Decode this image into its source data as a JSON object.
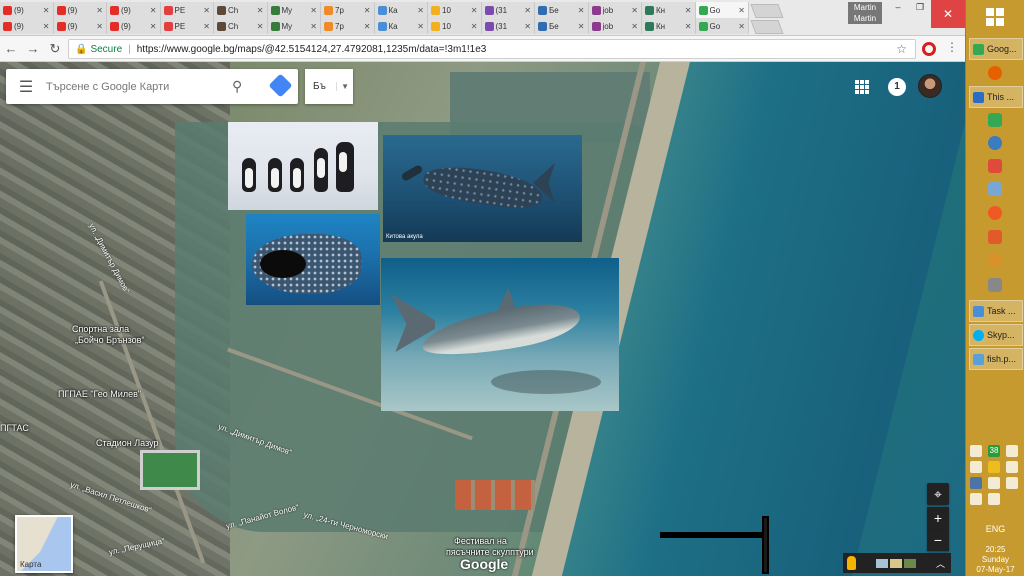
{
  "browser": {
    "tabs_row1": [
      {
        "label": "(9)",
        "color": "#e52d27"
      },
      {
        "label": "(9)",
        "color": "#e52d27"
      },
      {
        "label": "(9)",
        "color": "#e52d27"
      },
      {
        "label": "PE",
        "color": "#e43f3f"
      },
      {
        "label": "Ch",
        "color": "#5b4a3a"
      },
      {
        "label": "My",
        "color": "#3a7a3a"
      },
      {
        "label": "7p",
        "color": "#f08a24"
      },
      {
        "label": "Ка",
        "color": "#4a8fd6"
      },
      {
        "label": "10",
        "color": "#f2b01e"
      },
      {
        "label": "(31",
        "color": "#7d4bb0"
      },
      {
        "label": "Бе",
        "color": "#2f6db0"
      },
      {
        "label": "job",
        "color": "#8e3a8e"
      },
      {
        "label": "Кн",
        "color": "#2c7a5a"
      },
      {
        "label": "Go",
        "color": "#34a853"
      }
    ],
    "tabs_row2": [
      {
        "label": "(9)",
        "color": "#e52d27"
      },
      {
        "label": "(9)",
        "color": "#e52d27"
      },
      {
        "label": "(9)",
        "color": "#e52d27"
      },
      {
        "label": "PE",
        "color": "#e43f3f"
      },
      {
        "label": "Ch",
        "color": "#5b4a3a"
      },
      {
        "label": "My",
        "color": "#3a7a3a"
      },
      {
        "label": "7p",
        "color": "#f08a24"
      },
      {
        "label": "Ка",
        "color": "#4a8fd6"
      },
      {
        "label": "10",
        "color": "#f2b01e"
      },
      {
        "label": "(31",
        "color": "#7d4bb0"
      },
      {
        "label": "Бе",
        "color": "#2f6db0"
      },
      {
        "label": "job",
        "color": "#8e3a8e"
      },
      {
        "label": "Кн",
        "color": "#2c7a5a"
      },
      {
        "label": "Go",
        "color": "#34a853"
      }
    ],
    "profile_name": "Martin",
    "profile_name_2": "Martin",
    "secure_label": "Secure",
    "url": "https://www.google.bg/maps/@42.5154124,27.4792081,1235m/data=!3m1!1e3"
  },
  "maps": {
    "search_placeholder": "Търсене с Google Карти",
    "language": "Бъ",
    "notifications": "1",
    "minimap_label": "Карта",
    "google_logo": "Google",
    "labels": [
      "Спортна зала",
      "„Бойчо Брънзов“",
      "ПГПАЕ \"Гео Милев\"",
      "Стадион Лазур",
      "ПГТАС",
      "Фестивал на",
      "пясъчните скулптури"
    ],
    "streets": [
      "ул. „Димитър Димов“",
      "ул. „Димитър Димов“",
      "ул. „Васил Петлешков“",
      "ул. „Панайот Волов“",
      "ул. „24-ти Черноморски",
      "ул. „Перущица“"
    ],
    "photo_caption": "Китова акула"
  },
  "taskbar": {
    "items": [
      {
        "label": "Goog...",
        "color": "#34a853"
      },
      {
        "label": "This ...",
        "color": "#2b6cc4"
      },
      {
        "label": "Task ...",
        "color": "#4a8fd6"
      },
      {
        "label": "Skyp...",
        "color": "#00aff0"
      },
      {
        "label": "fish.p...",
        "color": "#5aa0d8"
      }
    ],
    "tray_badge": "38",
    "language": "ENG",
    "time": "20:25",
    "day": "Sunday",
    "date": "07-May-17"
  }
}
